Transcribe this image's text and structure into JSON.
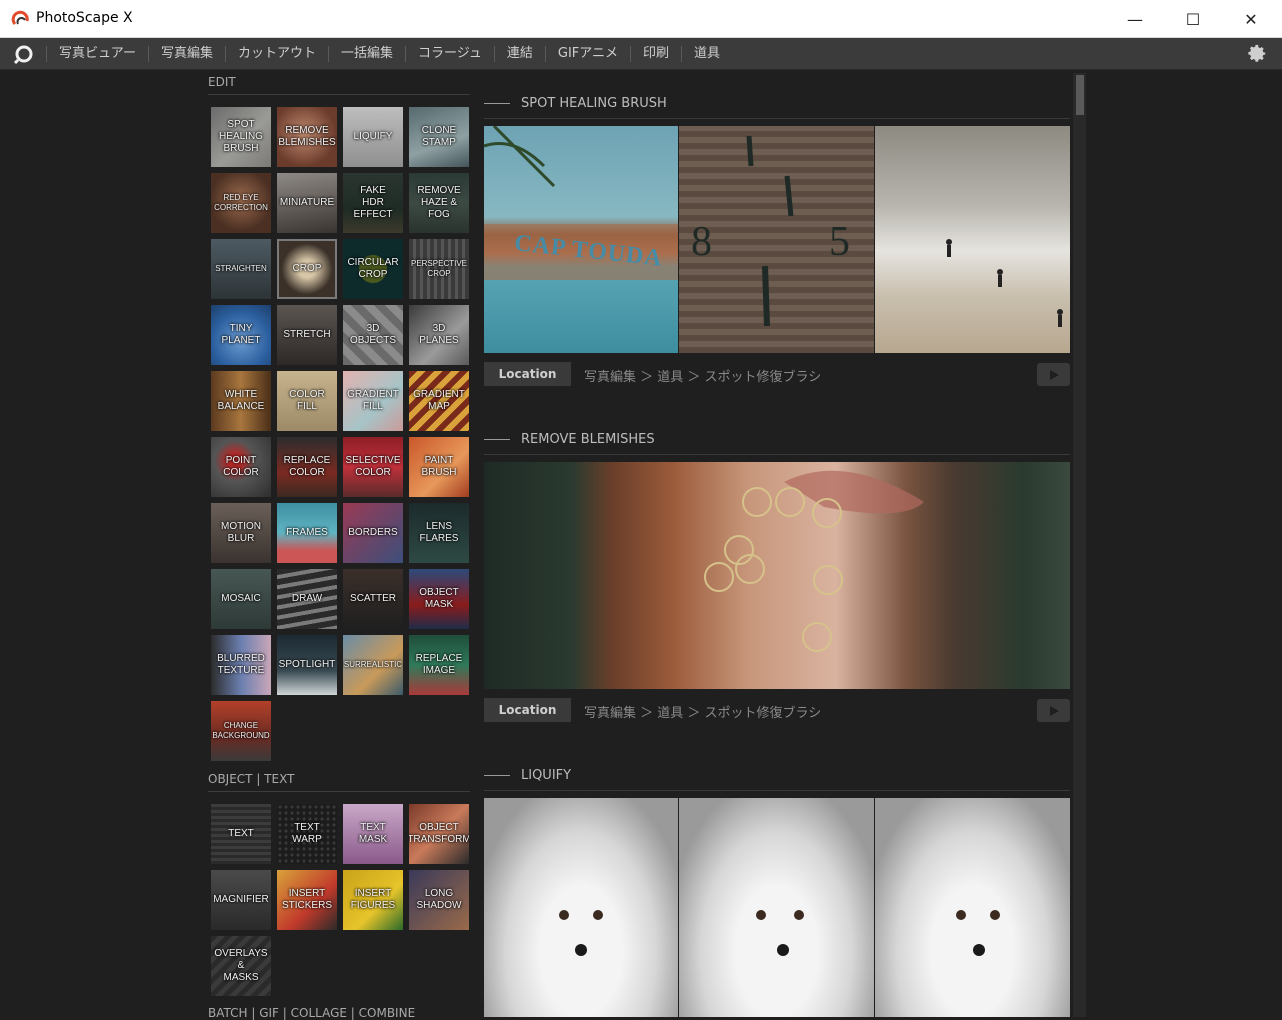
{
  "window": {
    "title": "PhotoScape X",
    "minimize": "—",
    "maximize": "☐",
    "close": "✕"
  },
  "menu": {
    "items": [
      "写真ビュアー",
      "写真編集",
      "カットアウト",
      "一括編集",
      "コラージュ",
      "連結",
      "GIFアニメ",
      "印刷",
      "道具"
    ]
  },
  "edit": {
    "heading": "EDIT",
    "tiles": [
      "SPOT\nHEALING\nBRUSH",
      "REMOVE\nBLEMISHES",
      "LIQUIFY",
      "CLONE\nSTAMP",
      "RED EYE\nCORRECTION",
      "MINIATURE",
      "FAKE\nHDR EFFECT",
      "REMOVE\nHAZE & FOG",
      "STRAIGHTEN",
      "CROP",
      "CIRCULAR\nCROP",
      "PERSPECTIVE\nCROP",
      "TINY\nPLANET",
      "STRETCH",
      "3D\nOBJECTS",
      "3D\nPLANES",
      "WHITE\nBALANCE",
      "COLOR\nFILL",
      "GRADIENT\nFILL",
      "GRADIENT\nMAP",
      "POINT\nCOLOR",
      "REPLACE\nCOLOR",
      "SELECTIVE\nCOLOR",
      "PAINT\nBRUSH",
      "MOTION\nBLUR",
      "FRAMES",
      "BORDERS",
      "LENS\nFLARES",
      "MOSAIC",
      "DRAW",
      "SCATTER",
      "OBJECT\nMASK",
      "BLURRED\nTEXTURE",
      "SPOTLIGHT",
      "SURREALISTIC",
      "REPLACE\nIMAGE",
      "CHANGE\nBACKGROUND"
    ]
  },
  "object_text": {
    "heading": "OBJECT  |  TEXT",
    "tiles": [
      "TEXT",
      "TEXT\nWARP",
      "TEXT\nMASK",
      "OBJECT\nTRANSFORM",
      "MAGNIFIER",
      "INSERT\nSTICKERS",
      "INSERT\nFIGURES",
      "LONG\nSHADOW",
      "OVERLAYS\n&\nMASKS"
    ]
  },
  "batch": {
    "heading": "BATCH  |  GIF  |  COLLAGE  |  COMBINE"
  },
  "features": [
    {
      "title": "SPOT HEALING BRUSH",
      "location_label": "Location",
      "path": "写真編集 ＞ 道具 ＞ スポット修復ブラシ"
    },
    {
      "title": "REMOVE BLEMISHES",
      "location_label": "Location",
      "path": "写真編集 ＞ 道具 ＞ スポット修復ブラシ"
    },
    {
      "title": "LIQUIFY"
    }
  ],
  "photo_text": {
    "boat": "CAP TOUDA",
    "num8": "8",
    "num5": "5"
  },
  "icons": {
    "logo": "photoscape-logo-icon",
    "home": "home-icon",
    "settings": "gear-icon",
    "play": "play-icon"
  }
}
